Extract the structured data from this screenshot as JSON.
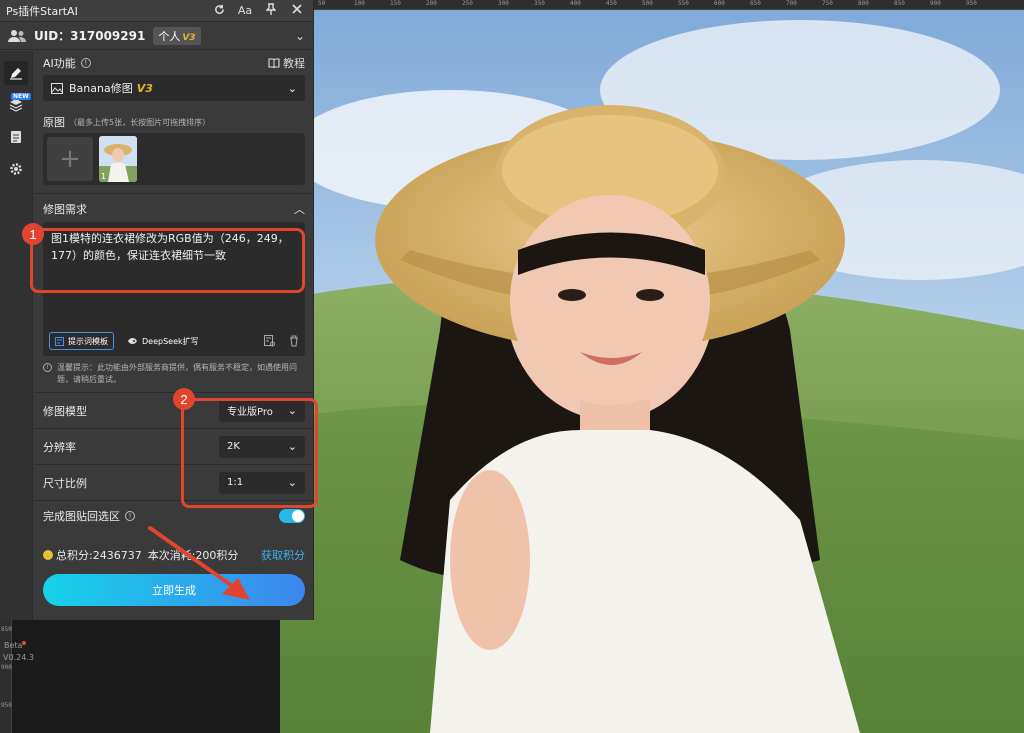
{
  "window": {
    "title": "Ps插件StartAI",
    "icons": [
      "refresh-icon",
      "font-size-icon",
      "pin-icon",
      "close-icon"
    ],
    "font_size_label": "Aa"
  },
  "account": {
    "uid_text": "UID：317009291",
    "plan_label": "个人",
    "plan_version": "V3"
  },
  "side_rail": {
    "items": [
      "edit-icon",
      "layers-icon",
      "document-icon",
      "settings-icon"
    ],
    "new_tag": "NEW",
    "beta_label": "Beta",
    "version_label": "V0.24.3"
  },
  "ai_function": {
    "label": "AI功能",
    "tutorial_label": "教程",
    "selected": "Banana修图",
    "selected_version": "V3"
  },
  "original_image": {
    "label": "原图",
    "hint": "（最多上传5张，长按图片可拖拽排序）",
    "thumb_index": "1"
  },
  "edit_request": {
    "label": "修图需求",
    "text": "图1模特的连衣裙修改为RGB值为（246，249，177）的颜色，保证连衣裙细节一致",
    "prompt_template_label": "提示词模板",
    "deepseek_label": "DeepSeek扩写"
  },
  "notice": {
    "text": "温馨提示：此功能由外部服务商提供，偶有服务不稳定，如遇使用问题，请稍后重试。"
  },
  "params": {
    "model_label": "修图模型",
    "model_value": "专业版Pro",
    "resolution_label": "分辨率",
    "resolution_value": "2K",
    "ratio_label": "尺寸比例",
    "ratio_value": "1:1"
  },
  "paste_back": {
    "label": "完成图贴回选区",
    "enabled": true
  },
  "points": {
    "total_text": "总积分:2436737",
    "cost_text": "本次消耗:200积分",
    "get_points_label": "获取积分"
  },
  "generate_button_label": "立即生成",
  "annotations": {
    "one": "1",
    "two": "2",
    "color": "#e2452f"
  },
  "ruler": {
    "top_ticks": [
      "50",
      "100",
      "150",
      "200",
      "250",
      "300",
      "350",
      "400",
      "450",
      "500",
      "550",
      "600",
      "650",
      "700",
      "750",
      "800",
      "850",
      "900",
      "950"
    ],
    "left_ticks": [
      "850",
      "900",
      "950"
    ]
  },
  "colors": {
    "panel_bg": "#3a3a3a",
    "accent_blue": "#3bb3f0",
    "gradient_start": "#16d3ea",
    "gradient_end": "#3d86ee",
    "toggle_on": "#27b7e8"
  }
}
